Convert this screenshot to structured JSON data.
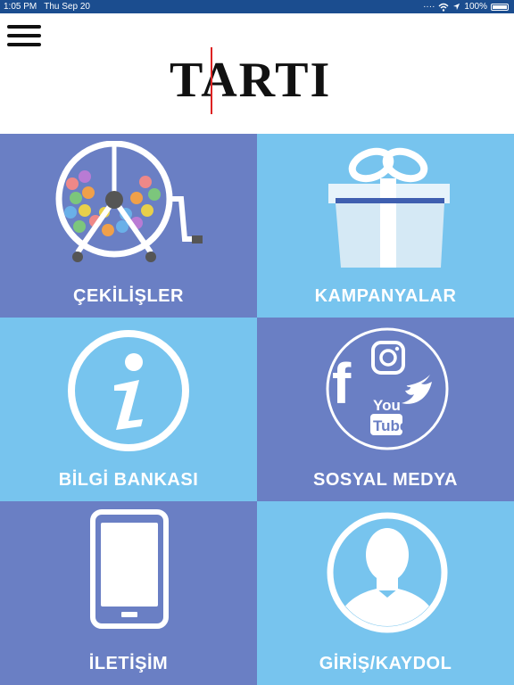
{
  "status_bar": {
    "time": "1:05 PM",
    "date": "Thu Sep 20",
    "battery": "100%",
    "icons": [
      "signal-dots-icon",
      "wifi-icon",
      "location-arrow-icon",
      "battery-icon"
    ]
  },
  "header": {
    "logo_text": "TARTI",
    "logo_accent_color": "#dd2222",
    "menu_icon": "hamburger-menu-icon"
  },
  "colors": {
    "tile_dark": "#6a7fc4",
    "tile_light": "#77c4ee",
    "status_bar": "#1b4d8f"
  },
  "tiles": [
    {
      "label": "ÇEKİLİŞLER",
      "icon": "lottery-drum-icon"
    },
    {
      "label": "KAMPANYALAR",
      "icon": "gift-box-icon"
    },
    {
      "label": "BİLGİ BANKASI",
      "icon": "info-icon"
    },
    {
      "label": "SOSYAL MEDYA",
      "icon": "social-media-icon"
    },
    {
      "label": "İLETİŞİM",
      "icon": "phone-device-icon"
    },
    {
      "label": "GİRİŞ/KAYDOL",
      "icon": "user-profile-icon"
    }
  ],
  "social_media_glyphs": {
    "facebook": "f",
    "youtube_top": "You",
    "youtube_bottom": "Tube"
  }
}
